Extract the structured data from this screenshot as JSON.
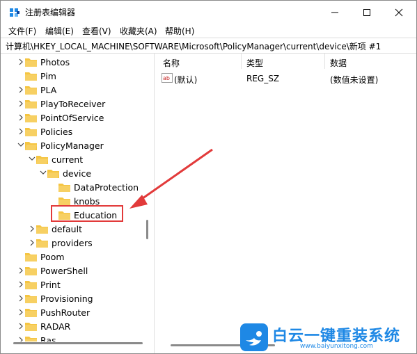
{
  "window": {
    "title": "注册表编辑器",
    "controls": {
      "minimize": "—",
      "maximize": "☐",
      "close": "✕"
    }
  },
  "menu": [
    "文件(F)",
    "编辑(E)",
    "查看(V)",
    "收藏夹(A)",
    "帮助(H)"
  ],
  "address": "计算机\\HKEY_LOCAL_MACHINE\\SOFTWARE\\Microsoft\\PolicyManager\\current\\device\\新项 #1",
  "tree": [
    {
      "label": "Photos"
    },
    {
      "label": "Pim"
    },
    {
      "label": "PLA"
    },
    {
      "label": "PlayToReceiver"
    },
    {
      "label": "PointOfService"
    },
    {
      "label": "Policies"
    },
    {
      "label": "PolicyManager"
    },
    {
      "label": "current"
    },
    {
      "label": "device"
    },
    {
      "label": "DataProtection"
    },
    {
      "label": "knobs"
    },
    {
      "label": "Education"
    },
    {
      "label": "default"
    },
    {
      "label": "providers"
    },
    {
      "label": "Poom"
    },
    {
      "label": "PowerShell"
    },
    {
      "label": "Print"
    },
    {
      "label": "Provisioning"
    },
    {
      "label": "PushRouter"
    },
    {
      "label": "RADAR"
    },
    {
      "label": "Ras"
    }
  ],
  "columns": {
    "name": "名称",
    "type": "类型",
    "data": "数据"
  },
  "values": [
    {
      "name": "(默认)",
      "type": "REG_SZ",
      "data": "(数值未设置)"
    }
  ],
  "watermark": {
    "brand": "白云一键重装系统",
    "url": "www.baiyunxitong.com"
  },
  "colors": {
    "folder": "#f5c542",
    "highlight": "#e23a3a",
    "accent": "#1e88e5"
  }
}
